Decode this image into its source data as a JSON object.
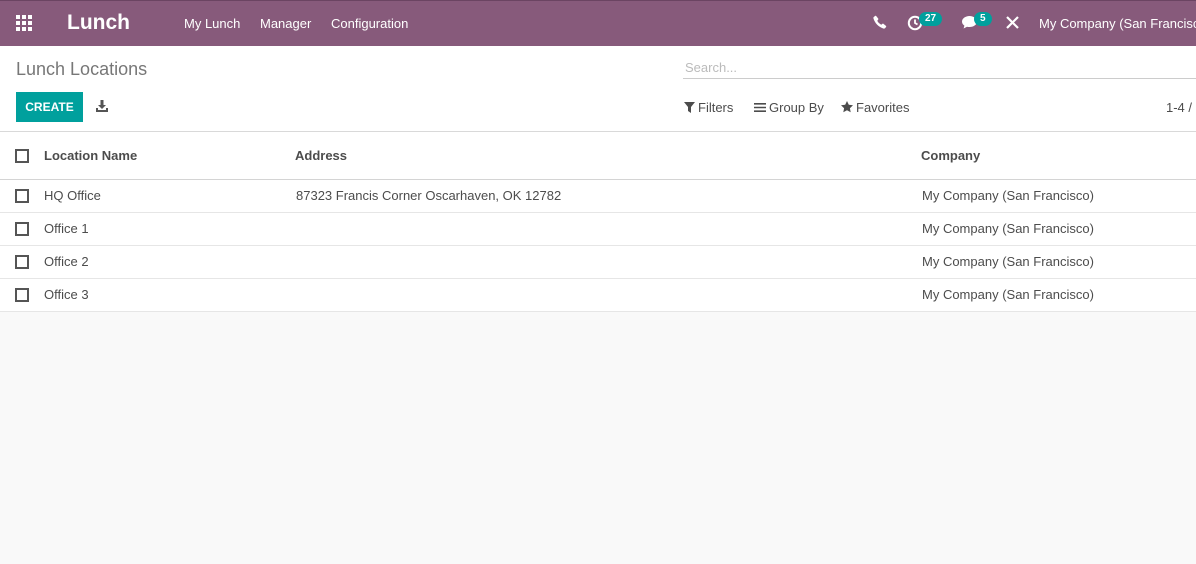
{
  "navbar": {
    "app_name": "Lunch",
    "menu": [
      "My Lunch",
      "Manager",
      "Configuration"
    ],
    "activity_count": "27",
    "message_count": "5",
    "company": "My Company (San Francisco)",
    "color": "#875a7b"
  },
  "control_panel": {
    "title": "Lunch Locations",
    "search_placeholder": "Search...",
    "create_label": "CREATE",
    "filters_label": "Filters",
    "group_by_label": "Group By",
    "favorites_label": "Favorites",
    "pager": "1-4 /"
  },
  "table": {
    "columns": [
      "Location Name",
      "Address",
      "Company"
    ],
    "rows": [
      {
        "name": "HQ Office",
        "address": "87323 Francis Corner Oscarhaven, OK 12782",
        "company": "My Company (San Francisco)"
      },
      {
        "name": "Office 1",
        "address": "",
        "company": "My Company (San Francisco)"
      },
      {
        "name": "Office 2",
        "address": "",
        "company": "My Company (San Francisco)"
      },
      {
        "name": "Office 3",
        "address": "",
        "company": "My Company (San Francisco)"
      }
    ]
  },
  "icons": {
    "apps": "grid-icon",
    "phone": "phone-icon",
    "activity": "clock-icon",
    "messages": "chat-icon",
    "debug": "close-tools-icon",
    "download": "download-icon",
    "filters": "filter-icon",
    "group_by": "list-icon",
    "favorites": "star-icon"
  },
  "colors": {
    "accent": "#00a09d",
    "brand": "#875a7b"
  }
}
